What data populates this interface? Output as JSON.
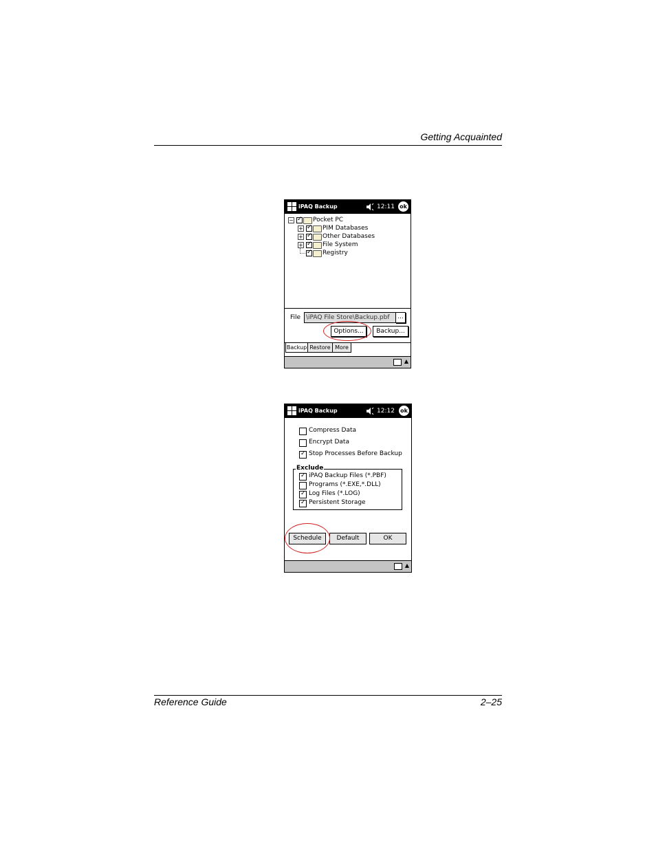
{
  "page": {
    "header": "Getting Acquainted",
    "footer_left": "Reference Guide",
    "footer_right": "2–25"
  },
  "screen1": {
    "title": "iPAQ Backup",
    "time": "12:11",
    "ok": "ok",
    "tree": [
      {
        "label": "Pocket PC",
        "checked": true
      },
      {
        "label": "PIM Databases",
        "checked": true
      },
      {
        "label": "Other Databases",
        "checked": true
      },
      {
        "label": "File System",
        "checked": true
      },
      {
        "label": "Registry",
        "checked": true
      }
    ],
    "file_label": "File",
    "file_value": "\\iPAQ File Store\\Backup.pbf",
    "browse_button": "...",
    "options_button": "Options...",
    "backup_button": "Backup...",
    "tabs": [
      "Backup",
      "Restore",
      "More"
    ]
  },
  "screen2": {
    "title": "iPAQ Backup",
    "time": "12:12",
    "ok": "ok",
    "options": [
      {
        "label": "Compress Data",
        "checked": false
      },
      {
        "label": "Encrypt Data",
        "checked": false
      },
      {
        "label": "Stop Processes Before Backup",
        "checked": true
      }
    ],
    "exclude_label": "Exclude",
    "exclude": [
      {
        "label": "iPAQ Backup Files (*.PBF)",
        "checked": true
      },
      {
        "label": "Programs (*.EXE,*.DLL)",
        "checked": false
      },
      {
        "label": "Log Files (*.LOG)",
        "checked": true
      },
      {
        "label": "Persistent Storage",
        "checked": true
      }
    ],
    "schedule_button": "Schedule",
    "default_button": "Default",
    "ok_button": "OK"
  }
}
